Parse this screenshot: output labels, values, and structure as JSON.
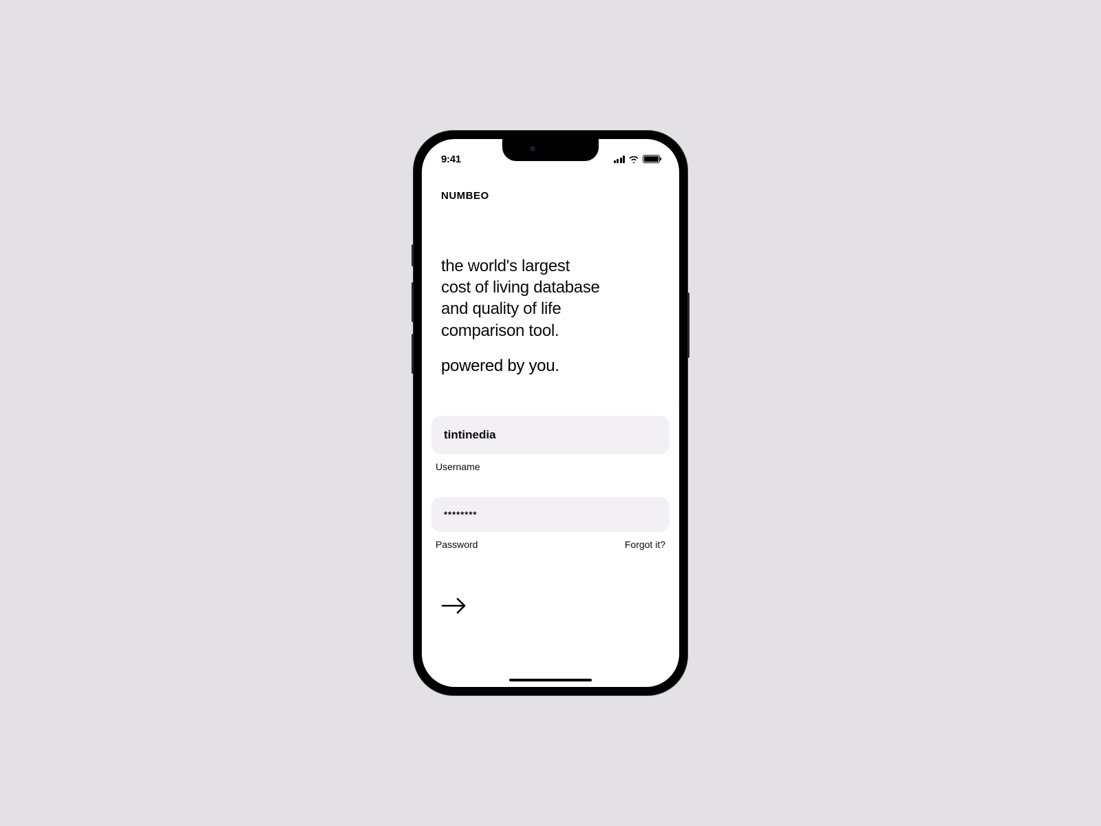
{
  "status": {
    "time": "9:41"
  },
  "brand": "NUMBEO",
  "hero": {
    "line1": "the world's largest",
    "line2": "cost of living database",
    "line3": "and quality of life",
    "line4": "comparison tool.",
    "tagline": "powered by you."
  },
  "form": {
    "username": {
      "value": "tintinedia",
      "label": "Username"
    },
    "password": {
      "value": "********",
      "label": "Password",
      "forgot": "Forgot it?"
    }
  }
}
